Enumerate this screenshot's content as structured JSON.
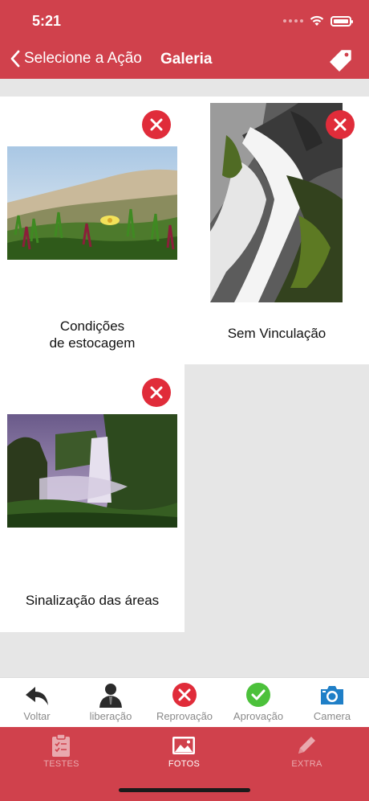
{
  "status_bar": {
    "time": "5:21"
  },
  "nav": {
    "back_label": "Selecione a Ação",
    "title": "Galeria"
  },
  "gallery": {
    "items": [
      {
        "caption": "Condições\nde estocagem"
      },
      {
        "caption": "Sem Vinculação"
      },
      {
        "caption": "Sinalização das áreas"
      }
    ]
  },
  "toolbar": {
    "items": [
      {
        "label": "Voltar",
        "icon": "reply-arrow-icon"
      },
      {
        "label": "liberação",
        "icon": "person-icon"
      },
      {
        "label": "Reprovação",
        "icon": "reject-icon"
      },
      {
        "label": "Aprovação",
        "icon": "approve-icon"
      },
      {
        "label": "Camera",
        "icon": "camera-icon"
      }
    ]
  },
  "tabbar": {
    "items": [
      {
        "label": "TESTES",
        "icon": "clipboard-icon"
      },
      {
        "label": "FOTOS",
        "icon": "photos-icon"
      },
      {
        "label": "EXTRA",
        "icon": "pencil-icon"
      }
    ]
  },
  "colors": {
    "brand_red": "#d0414c",
    "remove_red": "#e02c3a",
    "approve_green": "#4cc13b",
    "camera_blue": "#1f7fc7"
  }
}
